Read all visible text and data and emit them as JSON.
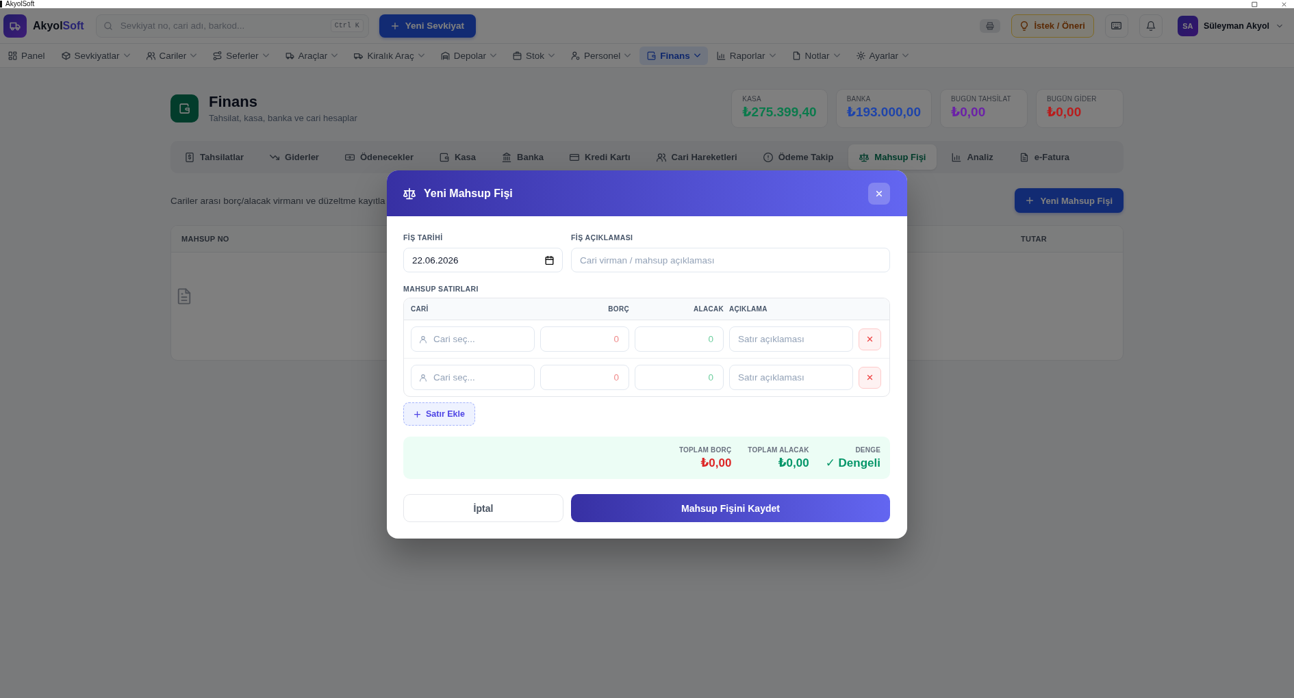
{
  "window": {
    "title": "AkyolSoft"
  },
  "header": {
    "brand": {
      "first": "Akyol",
      "second": "Soft"
    },
    "search": {
      "placeholder": "Sevkiyat no, cari adı, barkod...",
      "shortcut": "Ctrl K"
    },
    "new_button": "Yeni Sevkiyat",
    "suggestion_button": "İstek / Öneri",
    "user": {
      "initials": "SA",
      "name": "Süleyman Akyol"
    }
  },
  "nav": [
    {
      "label": "Panel",
      "menu": false,
      "selected": false
    },
    {
      "label": "Sevkiyatlar",
      "menu": true,
      "selected": false
    },
    {
      "label": "Cariler",
      "menu": true,
      "selected": false
    },
    {
      "label": "Seferler",
      "menu": true,
      "selected": false
    },
    {
      "label": "Araçlar",
      "menu": true,
      "selected": false
    },
    {
      "label": "Kiralık Araç",
      "menu": true,
      "selected": false
    },
    {
      "label": "Depolar",
      "menu": true,
      "selected": false
    },
    {
      "label": "Stok",
      "menu": true,
      "selected": false
    },
    {
      "label": "Personel",
      "menu": true,
      "selected": false
    },
    {
      "label": "Finans",
      "menu": true,
      "selected": true
    },
    {
      "label": "Raporlar",
      "menu": true,
      "selected": false
    },
    {
      "label": "Notlar",
      "menu": true,
      "selected": false
    },
    {
      "label": "Ayarlar",
      "menu": true,
      "selected": false
    }
  ],
  "page": {
    "title": "Finans",
    "subtitle": "Tahsilat, kasa, banka ve cari hesaplar",
    "stats": [
      {
        "label": "KASA",
        "value": "₺275.399,40",
        "color": "#0b7a4c"
      },
      {
        "label": "BANKA",
        "value": "₺193.000,00",
        "color": "#1e44aa"
      },
      {
        "label": "BUGÜN TAHSİLAT",
        "value": "₺0,00",
        "color": "#6b21a8"
      },
      {
        "label": "BUGÜN GİDER",
        "value": "₺0,00",
        "color": "#b91c1c"
      }
    ]
  },
  "tabs": [
    {
      "label": "Tahsilatlar",
      "selected": false
    },
    {
      "label": "Giderler",
      "selected": false
    },
    {
      "label": "Ödenecekler",
      "selected": false
    },
    {
      "label": "Kasa",
      "selected": false
    },
    {
      "label": "Banka",
      "selected": false
    },
    {
      "label": "Kredi Kartı",
      "selected": false
    },
    {
      "label": "Cari Hareketleri",
      "selected": false
    },
    {
      "label": "Ödeme Takip",
      "selected": false
    },
    {
      "label": "Mahsup Fişi",
      "selected": true
    },
    {
      "label": "Analiz",
      "selected": false
    },
    {
      "label": "e-Fatura",
      "selected": false
    }
  ],
  "section": {
    "description": "Cariler arası borç/alacak virmanı ve düzeltme kayıtla",
    "new_button": "Yeni Mahsup Fişi"
  },
  "table": {
    "columns": [
      "MAHSUP NO",
      "TUTAR"
    ]
  },
  "modal": {
    "title": "Yeni Mahsup Fişi",
    "fields": [
      {
        "kind": "date",
        "label": "FİŞ TARİHİ",
        "value": "22.06.2026"
      },
      {
        "kind": "text",
        "label": "FİŞ AÇIKLAMASI",
        "placeholder": "Cari virman / mahsup açıklaması"
      }
    ],
    "lines": {
      "label": "MAHSUP SATIRLARI",
      "columns": [
        "CARİ",
        "BORÇ",
        "ALACAK",
        "AÇIKLAMA"
      ],
      "rows": [
        {
          "account": {
            "placeholder": "Cari seç..."
          },
          "debit": {
            "placeholder": "0"
          },
          "credit": {
            "placeholder": "0"
          },
          "note": {
            "placeholder": "Satır açıklaması"
          }
        },
        {
          "account": {
            "placeholder": "Cari seç..."
          },
          "debit": {
            "placeholder": "0"
          },
          "credit": {
            "placeholder": "0"
          },
          "note": {
            "placeholder": "Satır açıklaması"
          }
        }
      ]
    },
    "add_row_button": "Satır Ekle",
    "totals": [
      {
        "label": "TOPLAM BORÇ",
        "value": "₺0,00",
        "color": "#dc2626"
      },
      {
        "label": "TOPLAM ALACAK",
        "value": "₺0,00",
        "color": "#059669"
      },
      {
        "label": "DENGE",
        "value": "✓ Dengeli",
        "color": "#059669"
      }
    ],
    "buttons": [
      {
        "kind": "secondary",
        "label": "İptal"
      },
      {
        "kind": "primary",
        "label": "Mahsup Fişini Kaydet"
      }
    ]
  }
}
